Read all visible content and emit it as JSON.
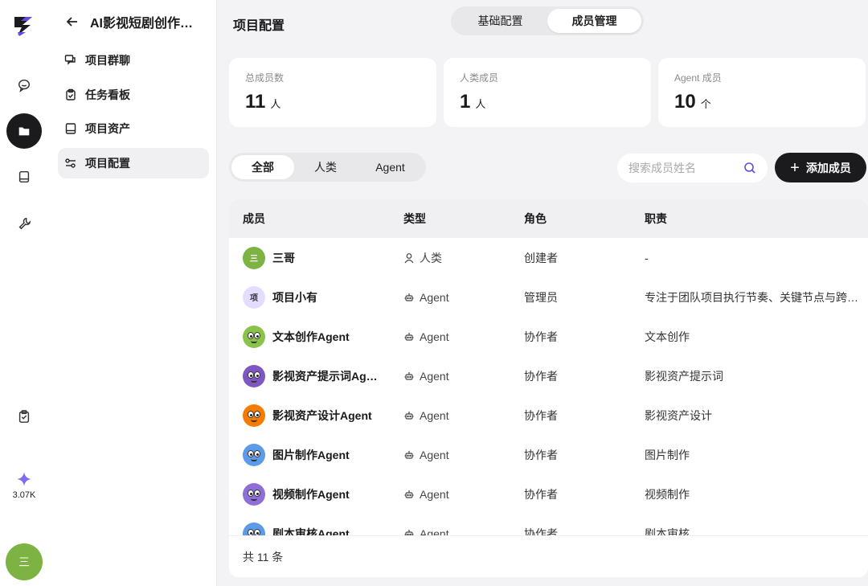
{
  "rail": {
    "credits": "3.07K",
    "avatar_char": "三"
  },
  "nav": {
    "title": "AI影视短剧创作…",
    "items": [
      {
        "label": "项目群聊",
        "icon": "chat-bubbles-icon"
      },
      {
        "label": "任务看板",
        "icon": "clipboard-icon"
      },
      {
        "label": "项目资产",
        "icon": "book-icon"
      },
      {
        "label": "项目配置",
        "icon": "sliders-icon"
      }
    ]
  },
  "main": {
    "title": "项目配置",
    "tabs": [
      "基础配置",
      "成员管理"
    ],
    "active_tab": "成员管理",
    "stats": [
      {
        "label": "总成员数",
        "value": "11",
        "unit": "人"
      },
      {
        "label": "人类成员",
        "value": "1",
        "unit": "人"
      },
      {
        "label": "Agent 成员",
        "value": "10",
        "unit": "个"
      }
    ],
    "filters": [
      "全部",
      "人类",
      "Agent"
    ],
    "active_filter": "全部",
    "search_placeholder": "搜索成员姓名",
    "add_button": "添加成员",
    "table": {
      "headers": [
        "成员",
        "类型",
        "角色",
        "职责"
      ],
      "rows": [
        {
          "name": "三哥",
          "avatar_text": "三",
          "type": "人类",
          "role": "创建者",
          "duty": "-"
        },
        {
          "name": "项目小有",
          "avatar_text": "项",
          "type": "Agent",
          "role": "管理员",
          "duty": "专注于团队项目执行节奏、关键节点与跨…"
        },
        {
          "name": "文本创作Agent",
          "avatar_text": "",
          "type": "Agent",
          "role": "协作者",
          "duty": "文本创作"
        },
        {
          "name": "影视资产提示词Ag…",
          "avatar_text": "",
          "type": "Agent",
          "role": "协作者",
          "duty": "影视资产提示词"
        },
        {
          "name": "影视资产设计Agent",
          "avatar_text": "",
          "type": "Agent",
          "role": "协作者",
          "duty": "影视资产设计"
        },
        {
          "name": "图片制作Agent",
          "avatar_text": "",
          "type": "Agent",
          "role": "协作者",
          "duty": "图片制作"
        },
        {
          "name": "视频制作Agent",
          "avatar_text": "",
          "type": "Agent",
          "role": "协作者",
          "duty": "视频制作"
        },
        {
          "name": "剧本审核Agent",
          "avatar_text": "",
          "type": "Agent",
          "role": "协作者",
          "duty": "剧本审核"
        }
      ],
      "footer": "共 11 条"
    },
    "colors": {
      "accent_dark": "#1b1b1d",
      "search_icon": "#5b4ee8",
      "credits_spark": "#7c6cf0"
    }
  }
}
